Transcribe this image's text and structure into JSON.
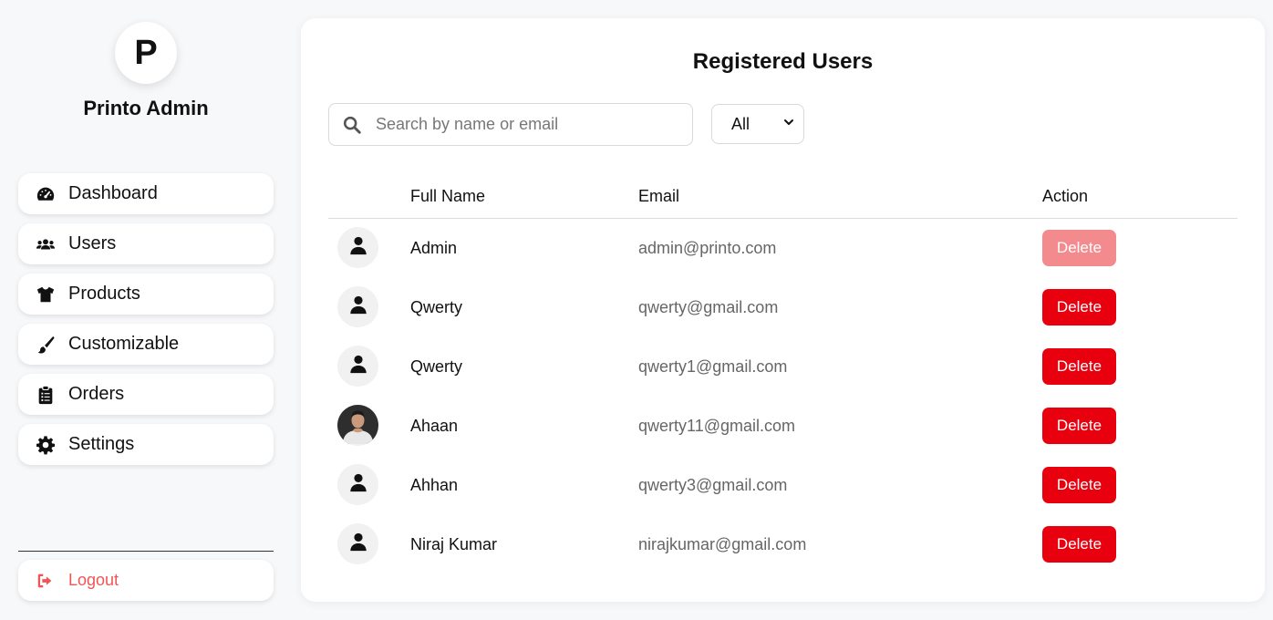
{
  "sidebar": {
    "avatar_letter": "P",
    "brand": "Printo Admin",
    "items": [
      {
        "label": "Dashboard",
        "icon": "dashboard-icon"
      },
      {
        "label": "Users",
        "icon": "users-icon"
      },
      {
        "label": "Products",
        "icon": "tshirt-icon"
      },
      {
        "label": "Customizable",
        "icon": "brush-icon"
      },
      {
        "label": "Orders",
        "icon": "clipboard-icon"
      },
      {
        "label": "Settings",
        "icon": "gear-icon"
      }
    ],
    "logout": {
      "label": "Logout",
      "icon": "logout-icon",
      "color": "#f05555"
    }
  },
  "main": {
    "title": "Registered Users",
    "search": {
      "placeholder": "Search by name or email",
      "value": ""
    },
    "filter": {
      "selected": "All"
    },
    "table": {
      "headers": {
        "name": "Full Name",
        "email": "Email",
        "action": "Action"
      },
      "delete_label": "Delete",
      "rows": [
        {
          "name": "Admin",
          "email": "admin@printo.com",
          "avatar": "user-icon",
          "delete_disabled": true
        },
        {
          "name": "Qwerty",
          "email": "qwerty@gmail.com",
          "avatar": "user-icon",
          "delete_disabled": false
        },
        {
          "name": "Qwerty",
          "email": "qwerty1@gmail.com",
          "avatar": "user-icon",
          "delete_disabled": false
        },
        {
          "name": "Ahaan",
          "email": "qwerty11@gmail.com",
          "avatar": "profile-photo",
          "delete_disabled": false
        },
        {
          "name": "Ahhan",
          "email": "qwerty3@gmail.com",
          "avatar": "user-icon",
          "delete_disabled": false
        },
        {
          "name": "Niraj Kumar",
          "email": "nirajkumar@gmail.com",
          "avatar": "user-icon",
          "delete_disabled": false
        }
      ]
    }
  },
  "colors": {
    "delete": "#e8000f",
    "delete_disabled": "#f38b8e",
    "logout": "#f05555",
    "background": "#f7f8fa"
  }
}
